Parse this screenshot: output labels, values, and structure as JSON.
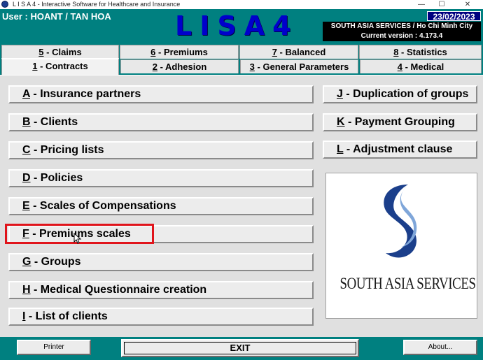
{
  "window": {
    "title": "L I S A 4 - Interactive Software for Healthcare and Insurance",
    "minimize": "—",
    "maximize": "☐",
    "close": "✕"
  },
  "header": {
    "user": "User : HOANT / TAN HOA",
    "logo": "LISA4",
    "date": "23/02/2023",
    "company": "SOUTH ASIA SERVICES / Ho Chi Minh City",
    "version": "Current version : 4.173.4"
  },
  "tabs": {
    "row_back": [
      {
        "key": "5",
        "label": " - Claims"
      },
      {
        "key": "6",
        "label": " - Premiums"
      },
      {
        "key": "7",
        "label": " - Balanced"
      },
      {
        "key": "8",
        "label": " - Statistics"
      }
    ],
    "row_front": [
      {
        "key": "1",
        "label": " - Contracts"
      },
      {
        "key": "2",
        "label": " - Adhesion"
      },
      {
        "key": "3",
        "label": " - General Parameters"
      },
      {
        "key": "4",
        "label": " - Medical"
      }
    ],
    "active_tab": "1 - Contracts"
  },
  "menu_left": [
    {
      "key": "A",
      "label": " - Insurance partners"
    },
    {
      "key": "B",
      "label": " - Clients"
    },
    {
      "key": "C",
      "label": " - Pricing lists"
    },
    {
      "key": "D",
      "label": " - Policies"
    },
    {
      "key": "E",
      "label": " - Scales of Compensations"
    },
    {
      "key": "F",
      "label": " - Premiums scales"
    },
    {
      "key": "G",
      "label": " - Groups"
    },
    {
      "key": "H",
      "label": " - Medical Questionnaire creation"
    },
    {
      "key": "I",
      "label": " - List of clients"
    }
  ],
  "menu_right": [
    {
      "key": "J",
      "label": " - Duplication of groups"
    },
    {
      "key": "K",
      "label": " - Payment Grouping"
    },
    {
      "key": "L",
      "label": " - Adjustment clause"
    }
  ],
  "highlighted_item": "F - Premiums scales",
  "logo_panel": {
    "caption": "SOUTH ASIA SERVICES",
    "logo_colors": {
      "dark": "#1b3f8b",
      "light": "#7fa6d9"
    }
  },
  "bottom": {
    "printer_label": "Printer",
    "exit_label": "EXIT",
    "about_label": "About..."
  },
  "colors": {
    "background": "#008080",
    "logo_text": "#0000cc",
    "highlight_border": "#e0141b",
    "date_bg": "#000080"
  }
}
